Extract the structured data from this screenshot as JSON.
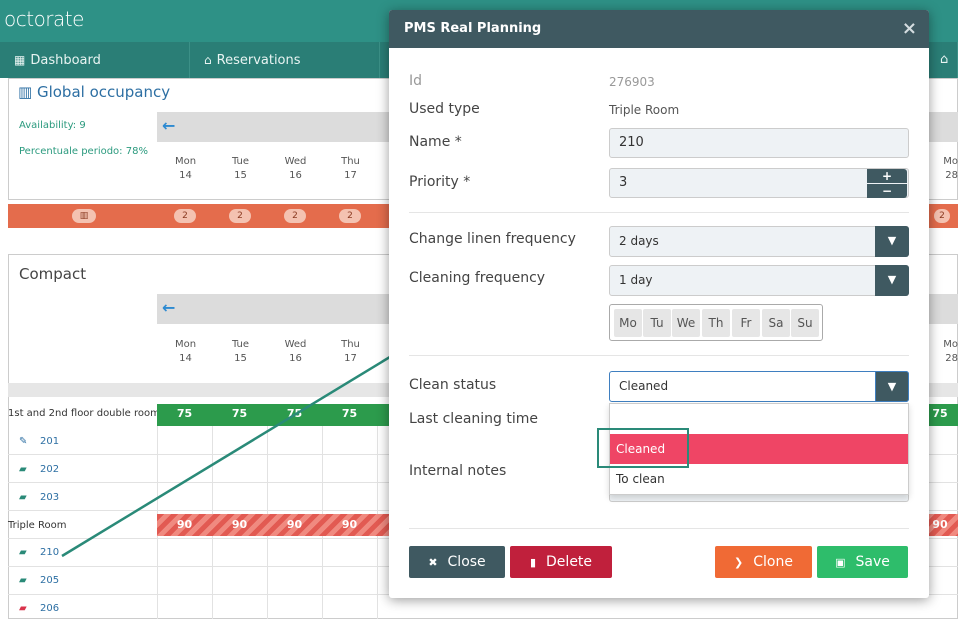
{
  "app": {
    "logo": "octorate",
    "nav": [
      {
        "label": "Dashboard",
        "icon": "dashboard-icon"
      },
      {
        "label": "Reservations",
        "icon": "reservations-icon"
      }
    ]
  },
  "background": {
    "occupancy": {
      "title": "Global occupancy",
      "availability": "Availability: 9",
      "percent": "Percentuale periodo: 78%",
      "days": [
        {
          "dow": "Mon",
          "num": "14"
        },
        {
          "dow": "Tue",
          "num": "15"
        },
        {
          "dow": "Wed",
          "num": "16"
        },
        {
          "dow": "Thu",
          "num": "17"
        }
      ],
      "right_day": {
        "dow": "Mo",
        "num": "28"
      },
      "counts": [
        "2",
        "2",
        "2",
        "2"
      ],
      "right_count": "2"
    },
    "compact": {
      "title": "Compact",
      "days": [
        {
          "dow": "Mon",
          "num": "14"
        },
        {
          "dow": "Tue",
          "num": "15"
        },
        {
          "dow": "Wed",
          "num": "16"
        },
        {
          "dow": "Thu",
          "num": "17"
        }
      ],
      "right_day": {
        "dow": "Mo",
        "num": "28"
      },
      "room_type_1": "1st and 2nd floor double room",
      "room_type_1_values": [
        "75",
        "75",
        "75",
        "75"
      ],
      "room_type_1_right": "75",
      "rooms_1": [
        "201",
        "202",
        "203"
      ],
      "room_type_2": "Triple Room",
      "room_type_2_values": [
        "90",
        "90",
        "90",
        "90"
      ],
      "room_type_2_right": "90",
      "rooms_2": [
        "210",
        "205",
        "206"
      ]
    }
  },
  "modal": {
    "title": "PMS Real Planning",
    "close_glyph": "×",
    "id_label": "Id",
    "id_value": "276903",
    "used_type_label": "Used type",
    "used_type_value": "Triple Room",
    "name_label": "Name  *",
    "name_value": "210",
    "priority_label": "Priority  *",
    "priority_value": "3",
    "change_linen_label": "Change linen frequency",
    "change_linen_value": "2 days",
    "cleaning_freq_label": "Cleaning frequency",
    "cleaning_freq_value": "1 day",
    "weekdays": [
      "Mo",
      "Tu",
      "We",
      "Th",
      "Fr",
      "Sa",
      "Su"
    ],
    "clean_status_label": "Clean status",
    "clean_status_value": "Cleaned",
    "clean_status_options": [
      "",
      "Cleaned",
      "To clean"
    ],
    "last_cleaning_label": "Last cleaning time",
    "internal_notes_label": "Internal notes",
    "buttons": {
      "close": "Close",
      "delete": "Delete",
      "clone": "Clone",
      "save": "Save"
    },
    "colors": {
      "header": "#3f5961",
      "delete": "#c0203c",
      "clone": "#f06a35",
      "save": "#2ebd6b",
      "selected_option": "#ef4565"
    }
  }
}
